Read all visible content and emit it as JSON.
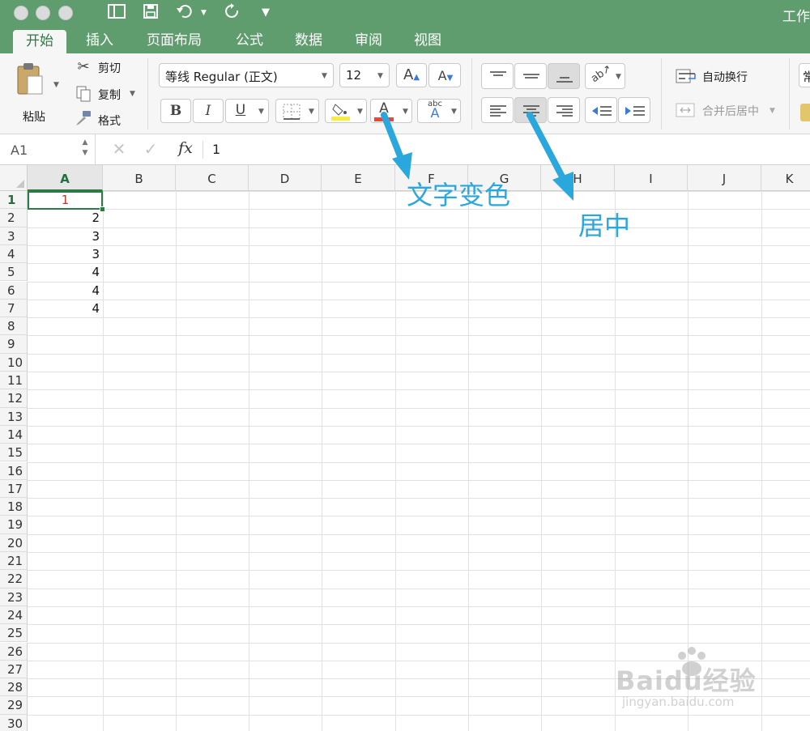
{
  "titlebar": {
    "doc_title": "工作"
  },
  "tabs": [
    {
      "label": "开始",
      "active": true
    },
    {
      "label": "插入"
    },
    {
      "label": "页面布局"
    },
    {
      "label": "公式"
    },
    {
      "label": "数据"
    },
    {
      "label": "审阅"
    },
    {
      "label": "视图"
    }
  ],
  "clipboard": {
    "paste_label": "粘贴",
    "cut_label": "剪切",
    "copy_label": "复制",
    "format_label": "格式"
  },
  "font": {
    "name": "等线 Regular (正文)",
    "size": "12",
    "fill_color": "#f6ee3a",
    "font_color": "#e8483c"
  },
  "alignment": {
    "wrap_label": "自动换行",
    "merge_label": "合并后居中"
  },
  "number_format": {
    "label": "常"
  },
  "formula_bar": {
    "name_box": "A1",
    "fx": "fx",
    "value": "1"
  },
  "sheet": {
    "columns": [
      "A",
      "B",
      "C",
      "D",
      "E",
      "F",
      "G",
      "H",
      "I",
      "J",
      "K"
    ],
    "rows": [
      "1",
      "2",
      "3",
      "4",
      "5",
      "6",
      "7",
      "8",
      "9",
      "10",
      "11",
      "12",
      "13",
      "14",
      "15",
      "16",
      "17",
      "18",
      "19",
      "20",
      "21",
      "22",
      "23",
      "24",
      "25",
      "26",
      "27",
      "28",
      "29",
      "30"
    ],
    "a_values": [
      "1",
      "2",
      "3",
      "3",
      "4",
      "4",
      "4"
    ],
    "a1_color": "#c0392b",
    "selected_cell": "A1"
  },
  "annotations": {
    "font_color_note": "文字变色",
    "center_note": "居中",
    "arrow_color": "#2aa7dc"
  },
  "watermark": {
    "brand": "Baidu经验",
    "url": "jingyan.baidu.com"
  }
}
